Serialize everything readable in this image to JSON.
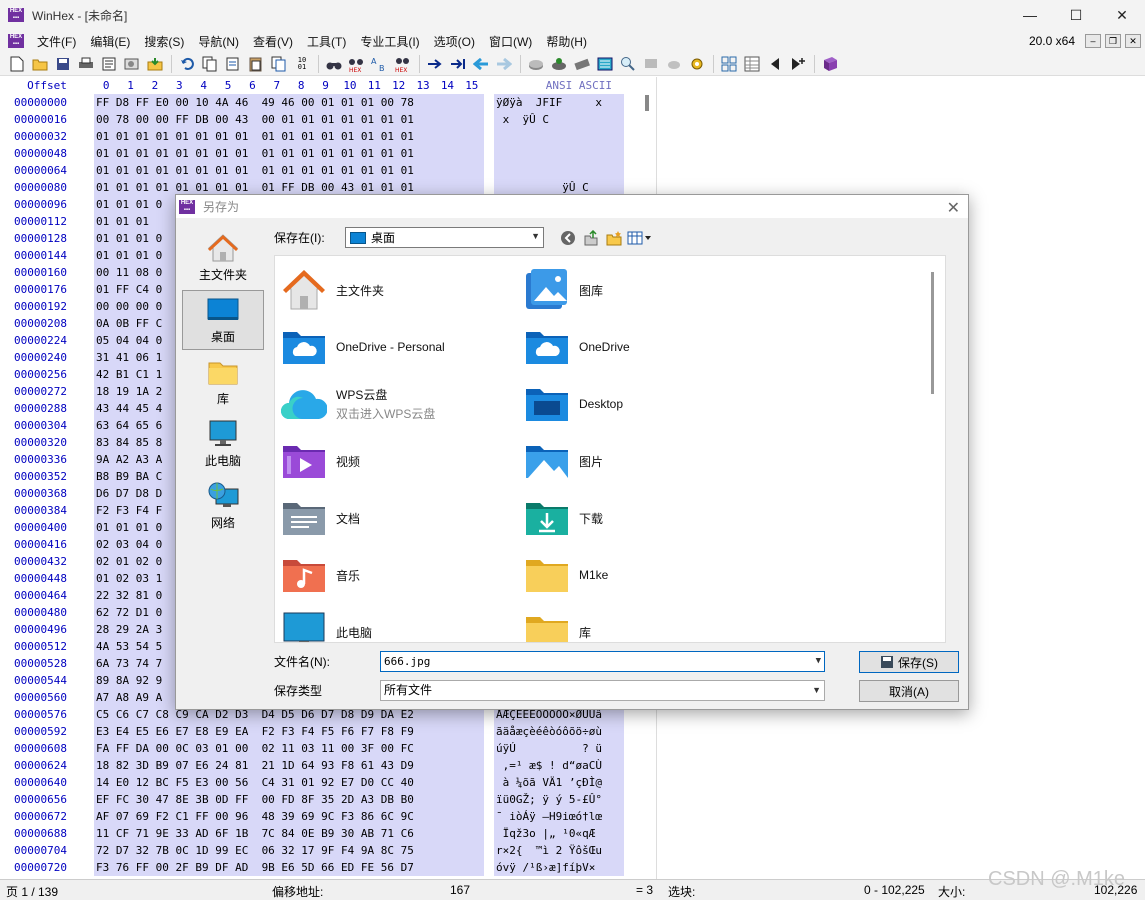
{
  "app": {
    "title": "WinHex - [未命名]",
    "logo_text": "HEX",
    "version": "20.0 x64"
  },
  "window_controls": [
    "—",
    "☐",
    "✕"
  ],
  "menu": [
    "文件(F)",
    "编辑(E)",
    "搜索(S)",
    "导航(N)",
    "查看(V)",
    "工具(T)",
    "专业工具(I)",
    "选项(O)",
    "窗口(W)",
    "帮助(H)"
  ],
  "toolbar_icons": [
    "new-file",
    "open-folder",
    "save",
    "print",
    "properties",
    "open-disk",
    "import",
    "undo",
    "copy",
    "cut",
    "paste",
    "paste-special",
    "copy-hex",
    "find",
    "find-hex",
    "replace",
    "replace-hex",
    "goto",
    "goto-offset",
    "back",
    "forward",
    "disk",
    "ram",
    "drive-image",
    "calculator",
    "zoom",
    "gray-1",
    "gray-2",
    "settings",
    "gallery",
    "table",
    "prev",
    "next-mark",
    "book"
  ],
  "hex": {
    "offset_label": "Offset",
    "columns": [
      "0",
      "1",
      "2",
      "3",
      "4",
      "5",
      "6",
      "7",
      "8",
      "9",
      "10",
      "11",
      "12",
      "13",
      "14",
      "15"
    ],
    "ansi_label": "ANSI ASCII",
    "rows": [
      {
        "off": "00000000",
        "bytes": "FF D8 FF E0 00 10 4A 46  49 46 00 01 01 01 00 78",
        "ansi": "ÿØÿà  JFIF     x"
      },
      {
        "off": "00000016",
        "bytes": "00 78 00 00 FF DB 00 43  00 01 01 01 01 01 01 01",
        "ansi": " x  ÿÛ C        "
      },
      {
        "off": "00000032",
        "bytes": "01 01 01 01 01 01 01 01  01 01 01 01 01 01 01 01",
        "ansi": ""
      },
      {
        "off": "00000048",
        "bytes": "01 01 01 01 01 01 01 01  01 01 01 01 01 01 01 01",
        "ansi": ""
      },
      {
        "off": "00000064",
        "bytes": "01 01 01 01 01 01 01 01  01 01 01 01 01 01 01 01",
        "ansi": ""
      },
      {
        "off": "00000080",
        "bytes": "01 01 01 01 01 01 01 01  01 FF DB 00 43 01 01 01",
        "ansi": "          ÿÛ C"
      },
      {
        "off": "00000096",
        "bytes": "01 01 01 0",
        "ansi": ""
      },
      {
        "off": "00000112",
        "bytes": "01 01 01",
        "ansi": ""
      },
      {
        "off": "00000128",
        "bytes": "01 01 01 0",
        "ansi": ""
      },
      {
        "off": "00000144",
        "bytes": "01 01 01 0",
        "ansi": ""
      },
      {
        "off": "00000160",
        "bytes": "00 11 08 0",
        "ansi": ""
      },
      {
        "off": "00000176",
        "bytes": "01 FF C4 0",
        "ansi": ""
      },
      {
        "off": "00000192",
        "bytes": "00 00 00 0",
        "ansi": ""
      },
      {
        "off": "00000208",
        "bytes": "0A 0B FF C",
        "ansi": ""
      },
      {
        "off": "00000224",
        "bytes": "05 04 04 0",
        "ansi": ""
      },
      {
        "off": "00000240",
        "bytes": "31 41 06 1",
        "ansi": ""
      },
      {
        "off": "00000256",
        "bytes": "42 B1 C1 1",
        "ansi": ""
      },
      {
        "off": "00000272",
        "bytes": "18 19 1A 2",
        "ansi": ""
      },
      {
        "off": "00000288",
        "bytes": "43 44 45 4",
        "ansi": ""
      },
      {
        "off": "00000304",
        "bytes": "63 64 65 6",
        "ansi": ""
      },
      {
        "off": "00000320",
        "bytes": "83 84 85 8",
        "ansi": ""
      },
      {
        "off": "00000336",
        "bytes": "9A A2 A3 A",
        "ansi": ""
      },
      {
        "off": "00000352",
        "bytes": "B8 B9 BA C",
        "ansi": ""
      },
      {
        "off": "00000368",
        "bytes": "D6 D7 D8 D",
        "ansi": ""
      },
      {
        "off": "00000384",
        "bytes": "F2 F3 F4 F",
        "ansi": ""
      },
      {
        "off": "00000400",
        "bytes": "01 01 01 0",
        "ansi": ""
      },
      {
        "off": "00000416",
        "bytes": "02 03 04 0",
        "ansi": ""
      },
      {
        "off": "00000432",
        "bytes": "02 01 02 0",
        "ansi": ""
      },
      {
        "off": "00000448",
        "bytes": "01 02 03 1",
        "ansi": ""
      },
      {
        "off": "00000464",
        "bytes": "22 32 81 0",
        "ansi": ""
      },
      {
        "off": "00000480",
        "bytes": "62 72 D1 0",
        "ansi": ""
      },
      {
        "off": "00000496",
        "bytes": "28 29 2A 3",
        "ansi": ""
      },
      {
        "off": "00000512",
        "bytes": "4A 53 54 5",
        "ansi": ""
      },
      {
        "off": "00000528",
        "bytes": "6A 73 74 7",
        "ansi": ""
      },
      {
        "off": "00000544",
        "bytes": "89 8A 92 9",
        "ansi": ""
      },
      {
        "off": "00000560",
        "bytes": "A7 A8 A9 A",
        "ansi": ""
      },
      {
        "off": "00000576",
        "bytes": "C5 C6 C7 C8 C9 CA D2 D3  D4 D5 D6 D7 D8 D9 DA E2",
        "ansi": "ÅÆÇÈÉÊÒÓÔÕÖ×ØÙÚâ"
      },
      {
        "off": "00000592",
        "bytes": "E3 E4 E5 E6 E7 E8 E9 EA  F2 F3 F4 F5 F6 F7 F8 F9",
        "ansi": "ãäåæçèéêòóôõö÷øù"
      },
      {
        "off": "00000608",
        "bytes": "FA FF DA 00 0C 03 01 00  02 11 03 11 00 3F 00 FC",
        "ansi": "úÿÚ          ? ü"
      },
      {
        "off": "00000624",
        "bytes": "18 82 3D B9 07 E6 24 81  21 1D 64 93 F8 61 43 D9",
        "ansi": " ‚=¹ æ$ ! d“øaCÙ"
      },
      {
        "off": "00000640",
        "bytes": "14 E0 12 BC F5 E3 00 56  C4 31 01 92 E7 D0 CC 40",
        "ansi": " à ¼õã VÄ1 ’çÐÌ@"
      },
      {
        "off": "00000656",
        "bytes": "EF FC 30 47 8E 3B 0D FF  00 FD 8F 35 2D A3 DB B0",
        "ansi": "ïü0GŽ; ÿ ý 5-£Û°"
      },
      {
        "off": "00000672",
        "bytes": "AF 07 69 F2 C1 FF 00 96  48 39 69 9C F3 86 6C 9C",
        "ansi": "¯ iòÁÿ –H9iœó†lœ"
      },
      {
        "off": "00000688",
        "bytes": "11 CF 71 9E 33 AD 6F 1B  7C 84 0E B9 30 AB 71 C6",
        "ansi": " Ïqž3­o |„ ¹0«qÆ"
      },
      {
        "off": "00000704",
        "bytes": "72 D7 32 7B 0C 1D 99 EC  06 32 17 9F F4 9A 8C 75",
        "ansi": "r×2{  ™ì 2 ŸôšŒu"
      },
      {
        "off": "00000720",
        "bytes": "F3 76 FF 00 2F B9 DF AD  9B E6 5D 66 ED FE 56 D7",
        "ansi": "óvÿ /¹ß­›æ]fíþV×"
      }
    ]
  },
  "status": {
    "page": "页 1 / 139",
    "offset_label": "偏移地址:",
    "offset_value": "167",
    "eq": "= 3",
    "sel_label": "选块:",
    "sel_value": "0 - 102,225",
    "size_label": "大小:",
    "size_value": "102,226"
  },
  "dialog": {
    "title": "另存为",
    "close": "✕",
    "places": [
      {
        "label": "主文件夹",
        "icon": "home-icon"
      },
      {
        "label": "桌面",
        "icon": "desktop-icon",
        "active": true
      },
      {
        "label": "库",
        "icon": "library-icon"
      },
      {
        "label": "此电脑",
        "icon": "computer-icon"
      },
      {
        "label": "网络",
        "icon": "network-icon"
      }
    ],
    "save_in_label": "保存在(I):",
    "save_in_value": "桌面",
    "items": [
      {
        "name": "主文件夹",
        "sub": "",
        "icon": "home-icon"
      },
      {
        "name": "图库",
        "sub": "",
        "icon": "gallery-icon"
      },
      {
        "name": "OneDrive - Personal",
        "sub": "",
        "icon": "onedrive-folder-icon"
      },
      {
        "name": "OneDrive",
        "sub": "",
        "icon": "onedrive-folder-icon"
      },
      {
        "name": "WPS云盘",
        "sub": "双击进入WPS云盘",
        "icon": "wps-cloud-icon"
      },
      {
        "name": "Desktop",
        "sub": "",
        "icon": "desktop-folder-icon"
      },
      {
        "name": "视频",
        "sub": "",
        "icon": "videos-folder-icon"
      },
      {
        "name": "图片",
        "sub": "",
        "icon": "pictures-folder-icon"
      },
      {
        "name": "文档",
        "sub": "",
        "icon": "documents-folder-icon"
      },
      {
        "name": "下载",
        "sub": "",
        "icon": "downloads-folder-icon"
      },
      {
        "name": "音乐",
        "sub": "",
        "icon": "music-folder-icon"
      },
      {
        "name": "M1ke",
        "sub": "",
        "icon": "folder-icon"
      },
      {
        "name": "此电脑",
        "sub": "",
        "icon": "computer-icon"
      },
      {
        "name": "库",
        "sub": "",
        "icon": "folder-icon"
      }
    ],
    "filename_label": "文件名(N):",
    "filename_value": "666.jpg",
    "filetype_label": "保存类型",
    "filetype_value": "所有文件",
    "save_button": "保存(S)",
    "cancel_button": "取消(A)"
  },
  "watermark": "CSDN @.M1ke",
  "colors": {
    "selection": "#d8d8f8",
    "offset_blue": "#0000c0",
    "folder_blue": "#0c83d5",
    "folder_yellow": "#f8c94b"
  }
}
